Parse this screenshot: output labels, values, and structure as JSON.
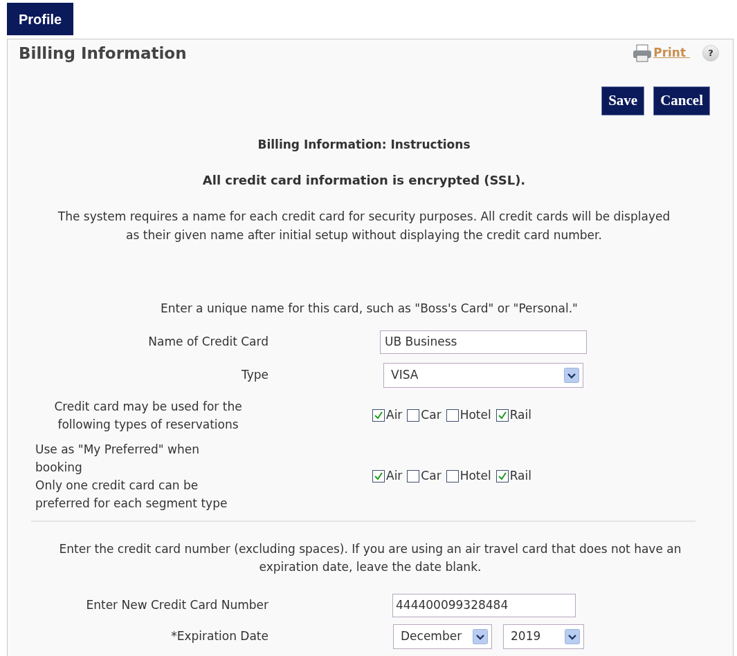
{
  "tab": {
    "label": "Profile"
  },
  "panel": {
    "title": "Billing Information",
    "print_link": "Print",
    "help": "?"
  },
  "buttons": [
    "Save",
    "Cancel"
  ],
  "instructions_heading": "Billing Information: Instructions",
  "encryption_note": "All credit card information is encrypted (SSL).",
  "intro": "The system requires a name for each credit card for security purposes. All credit cards will be displayed as their given name after initial setup without displaying the credit card number.",
  "name_hint": "Enter a unique name for this card, such as \"Boss's Card\" or \"Personal.\"",
  "card_name": {
    "label": "Name of Credit Card",
    "value": "UB Business"
  },
  "card_type": {
    "label": "Type",
    "value": "VISA"
  },
  "usage": {
    "label": "Credit card may be used for the following types of reservations",
    "options": [
      {
        "label": "Air",
        "checked": true
      },
      {
        "label": "Car",
        "checked": false
      },
      {
        "label": "Hotel",
        "checked": false
      },
      {
        "label": "Rail",
        "checked": true
      }
    ]
  },
  "preferred": {
    "label_lines": [
      "Use as \"My Preferred\" when booking",
      "Only one credit card can be preferred for each segment type"
    ],
    "options": [
      {
        "label": "Air",
        "checked": true
      },
      {
        "label": "Car",
        "checked": false
      },
      {
        "label": "Hotel",
        "checked": false
      },
      {
        "label": "Rail",
        "checked": true
      }
    ]
  },
  "number_hint": "Enter the credit card number (excluding spaces). If you are using an air travel card that does not have an expiration date, leave the date blank.",
  "card_number": {
    "label": "Enter New Credit Card Number",
    "value": "444400099328484"
  },
  "expiration": {
    "label": "*Expiration Date",
    "month": "December",
    "year": "2019"
  }
}
